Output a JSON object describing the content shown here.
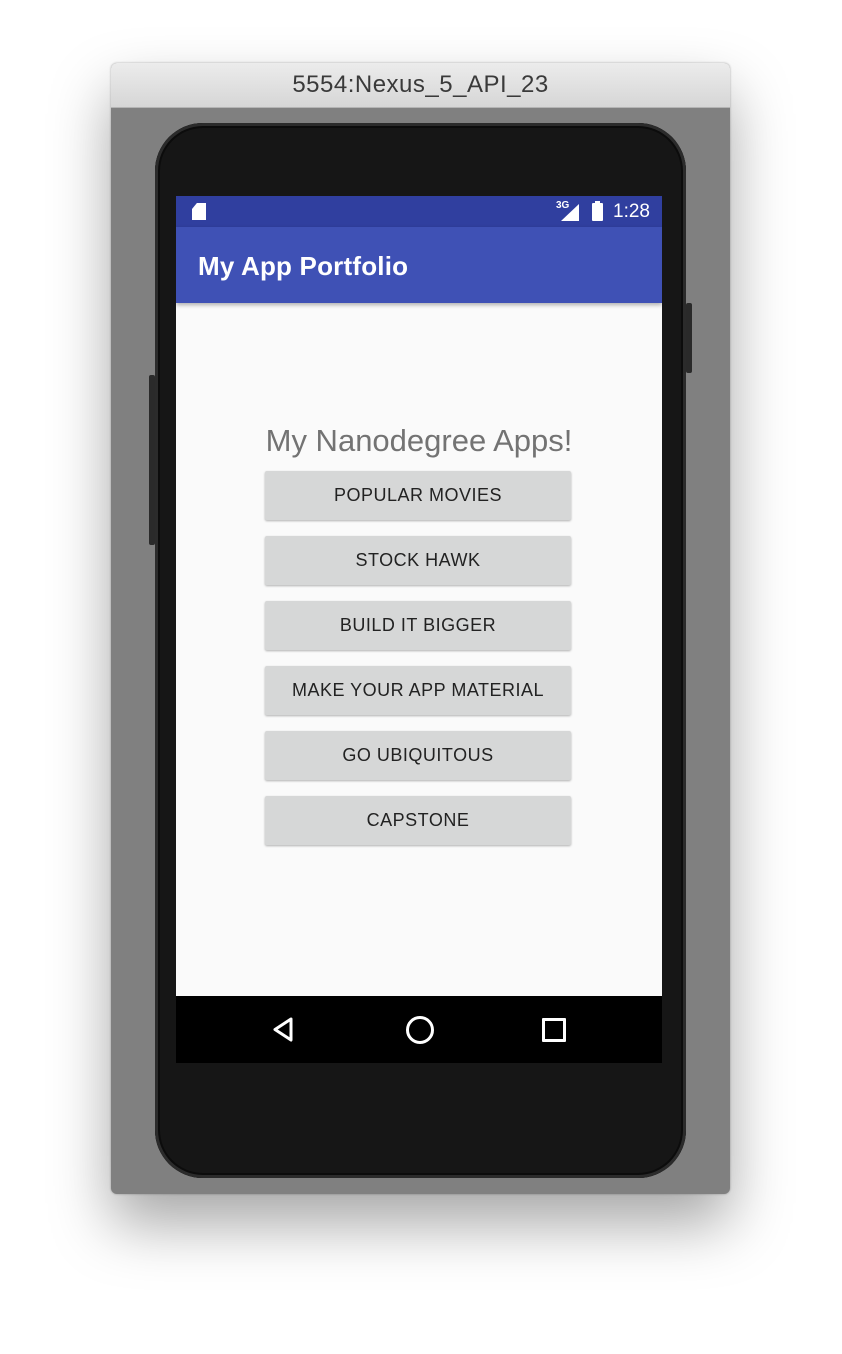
{
  "window": {
    "title": "5554:Nexus_5_API_23"
  },
  "statusbar": {
    "network": "3G",
    "time": "1:28"
  },
  "appbar": {
    "title": "My App Portfolio"
  },
  "main": {
    "heading": "My Nanodegree Apps!",
    "buttons": [
      {
        "label": "POPULAR MOVIES"
      },
      {
        "label": "STOCK HAWK"
      },
      {
        "label": "BUILD IT BIGGER"
      },
      {
        "label": "MAKE YOUR APP MATERIAL"
      },
      {
        "label": "GO UBIQUITOUS"
      },
      {
        "label": "CAPSTONE"
      }
    ]
  },
  "navbar": {
    "icons": [
      "back-icon",
      "home-icon",
      "recent-apps-icon"
    ]
  },
  "colors": {
    "statusbar": "#303f9f",
    "appbar": "#3f51b5",
    "button": "#d6d7d7"
  }
}
